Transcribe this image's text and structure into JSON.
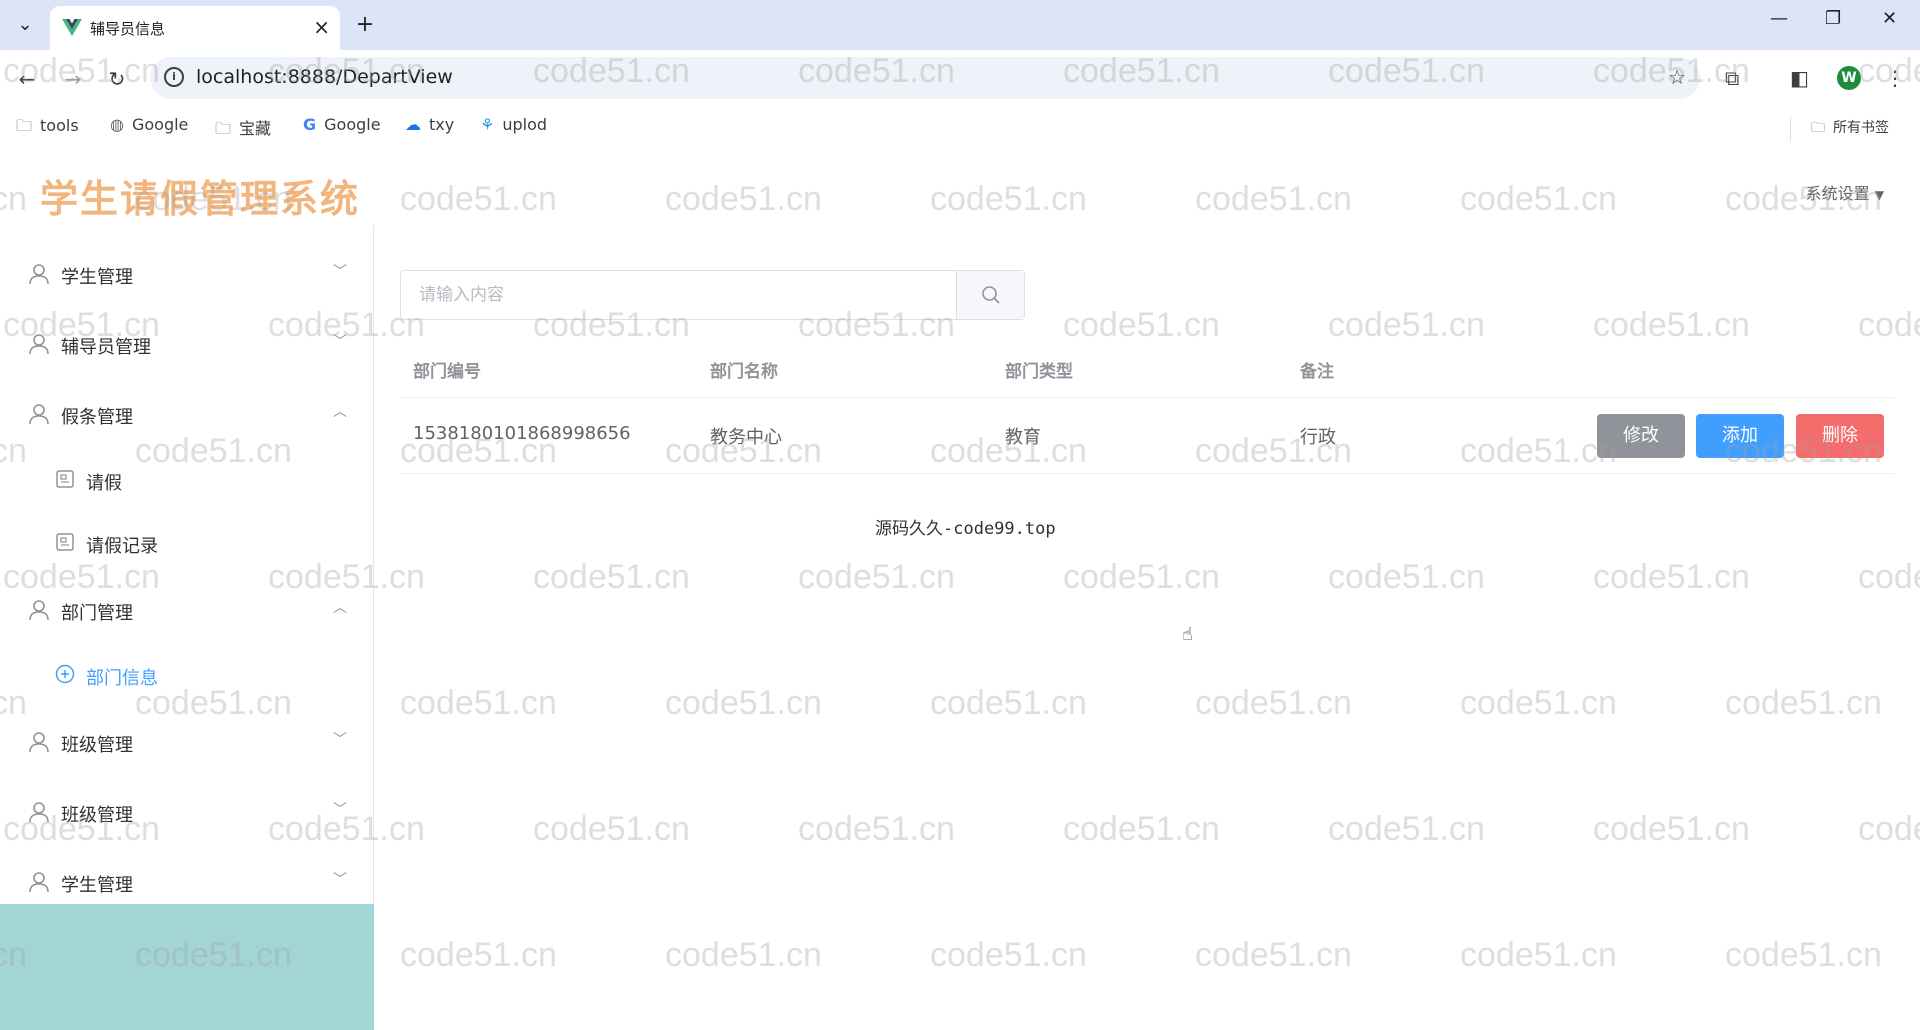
{
  "browser": {
    "tab_title": "辅导员信息",
    "url": "localhost:8888/DepartView",
    "bookmarks": [
      {
        "label": "tools",
        "icon": "folder-icon"
      },
      {
        "label": "Google",
        "icon": "globe-icon"
      },
      {
        "label": "宝藏",
        "icon": "folder-icon"
      },
      {
        "label": "Google",
        "icon": "google-icon"
      },
      {
        "label": "txy",
        "icon": "cloud-icon"
      },
      {
        "label": "uplod",
        "icon": "upload-icon"
      }
    ],
    "all_bookmarks": "所有书签",
    "profile_initial": "W"
  },
  "app": {
    "title": "学生请假管理系统",
    "settings_label": "系统设置",
    "sidebar": {
      "menus": [
        {
          "label": "学生管理"
        },
        {
          "label": "辅导员管理"
        },
        {
          "label": "假条管理"
        },
        {
          "label": "部门管理"
        },
        {
          "label": "班级管理"
        },
        {
          "label": "班级管理"
        },
        {
          "label": "学生管理"
        }
      ],
      "sub_leave": [
        {
          "label": "请假"
        },
        {
          "label": "请假记录"
        }
      ],
      "sub_depart": [
        {
          "label": "部门信息"
        }
      ]
    },
    "search": {
      "placeholder": "请输入内容",
      "value": ""
    },
    "table": {
      "headers": [
        "部门编号",
        "部门名称",
        "部门类型",
        "备注"
      ],
      "rows": [
        {
          "id": "1538180101868998656",
          "name": "教务中心",
          "type": "教育",
          "note": "行政"
        }
      ]
    },
    "actions": {
      "edit": "修改",
      "add": "添加",
      "delete": "删除"
    },
    "footer": "源码久久-code99.top",
    "watermark": "code51.cn"
  },
  "colors": {
    "primary": "#409eff",
    "danger": "#f56c6c",
    "info": "#909399",
    "title_orange": "#f0a968",
    "sidebar_bottom": "#a3d4d6"
  }
}
